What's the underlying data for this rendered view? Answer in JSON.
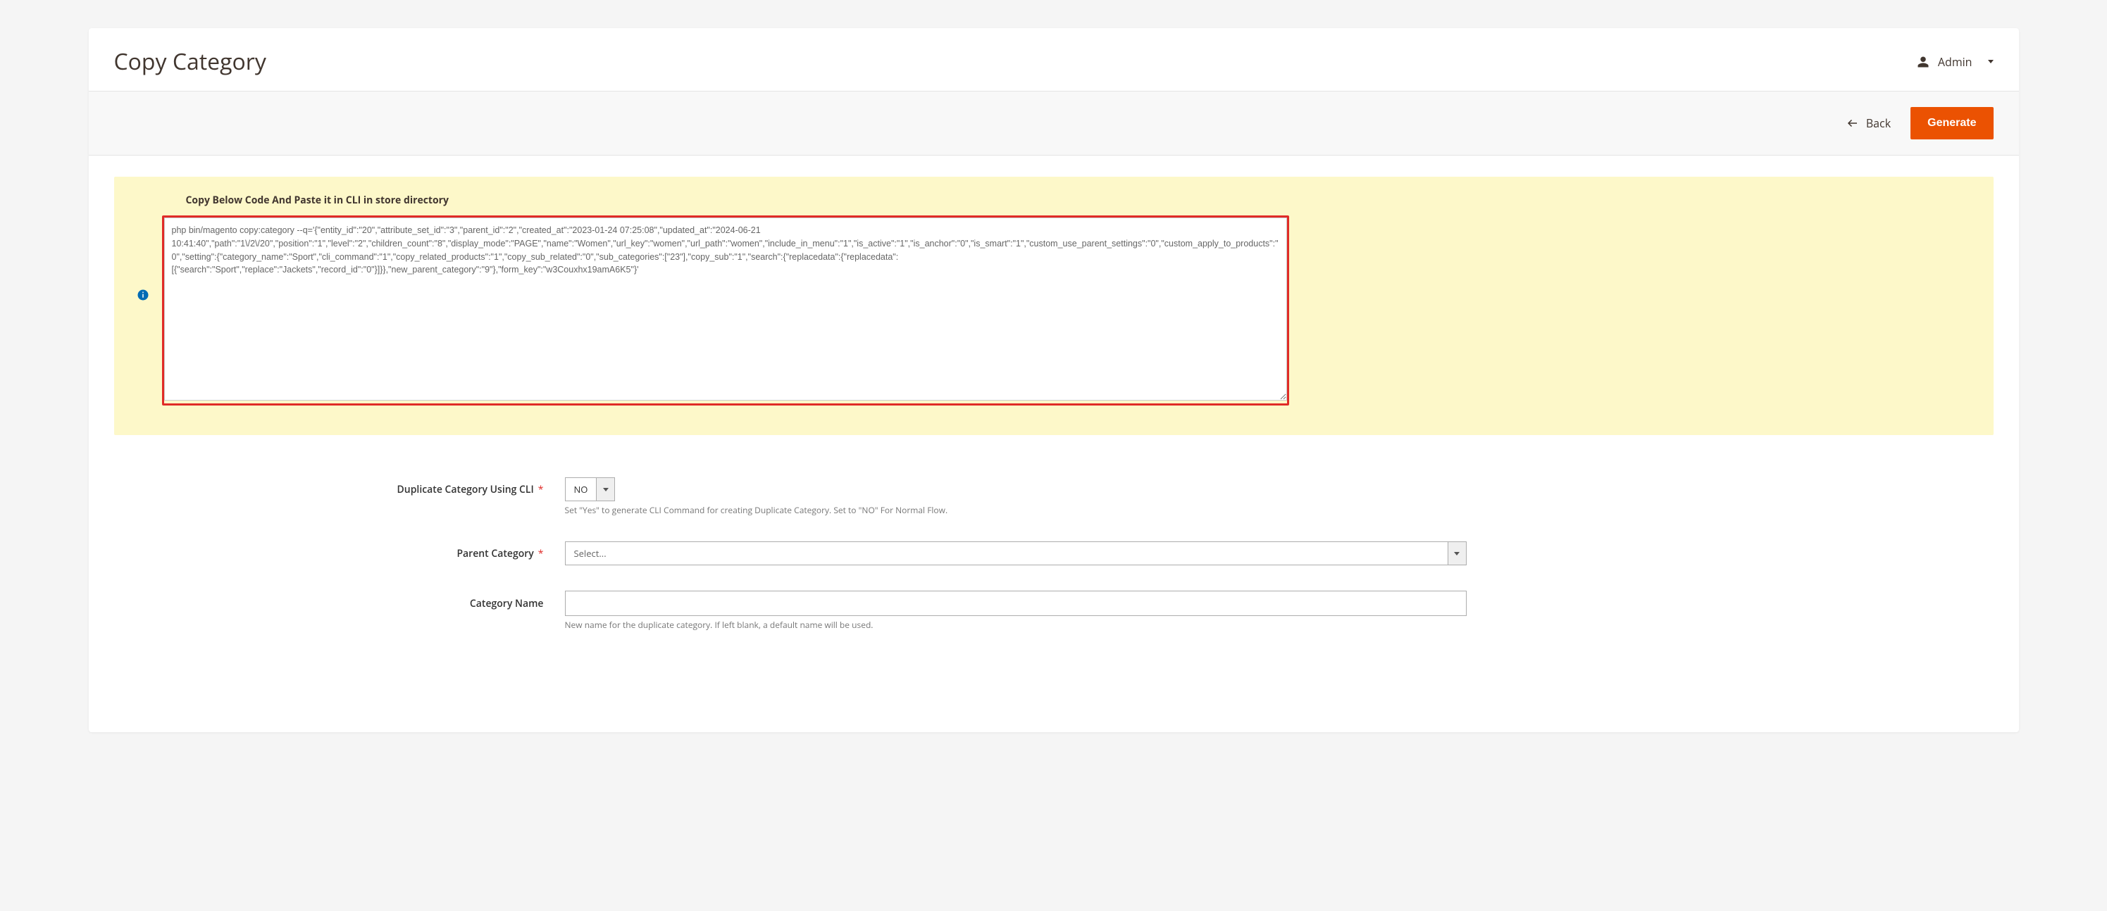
{
  "header": {
    "title": "Copy Category",
    "user_label": "Admin"
  },
  "toolbar": {
    "back_label": "Back",
    "generate_label": "Generate"
  },
  "notice": {
    "title": "Copy Below Code And Paste it in CLI in store directory",
    "cli_text": "php bin/magento copy:category --q='{\"entity_id\":\"20\",\"attribute_set_id\":\"3\",\"parent_id\":\"2\",\"created_at\":\"2023-01-24 07:25:08\",\"updated_at\":\"2024-06-21 10:41:40\",\"path\":\"1\\/2\\/20\",\"position\":\"1\",\"level\":\"2\",\"children_count\":\"8\",\"display_mode\":\"PAGE\",\"name\":\"Women\",\"url_key\":\"women\",\"url_path\":\"women\",\"include_in_menu\":\"1\",\"is_active\":\"1\",\"is_anchor\":\"0\",\"is_smart\":\"1\",\"custom_use_parent_settings\":\"0\",\"custom_apply_to_products\":\"0\",\"setting\":{\"category_name\":\"Sport\",\"cli_command\":\"1\",\"copy_related_products\":\"1\",\"copy_sub_related\":\"0\",\"sub_categories\":[\"23\"],\"copy_sub\":\"1\",\"search\":{\"replacedata\":{\"replacedata\":[{\"search\":\"Sport\",\"replace\":\"Jackets\",\"record_id\":\"0\"}]}},\"new_parent_category\":\"9\"},\"form_key\":\"w3Couxhx19amA6K5\"}'"
  },
  "form": {
    "cli_toggle": {
      "label": "Duplicate Category Using CLI",
      "value": "NO",
      "hint": "Set \"Yes\" to generate CLI Command for creating Duplicate Category. Set to \"NO\" For Normal Flow."
    },
    "parent": {
      "label": "Parent Category",
      "value": "Select..."
    },
    "name": {
      "label": "Category Name",
      "value": "",
      "hint": "New name for the duplicate category. If left blank, a default name will be used."
    }
  }
}
